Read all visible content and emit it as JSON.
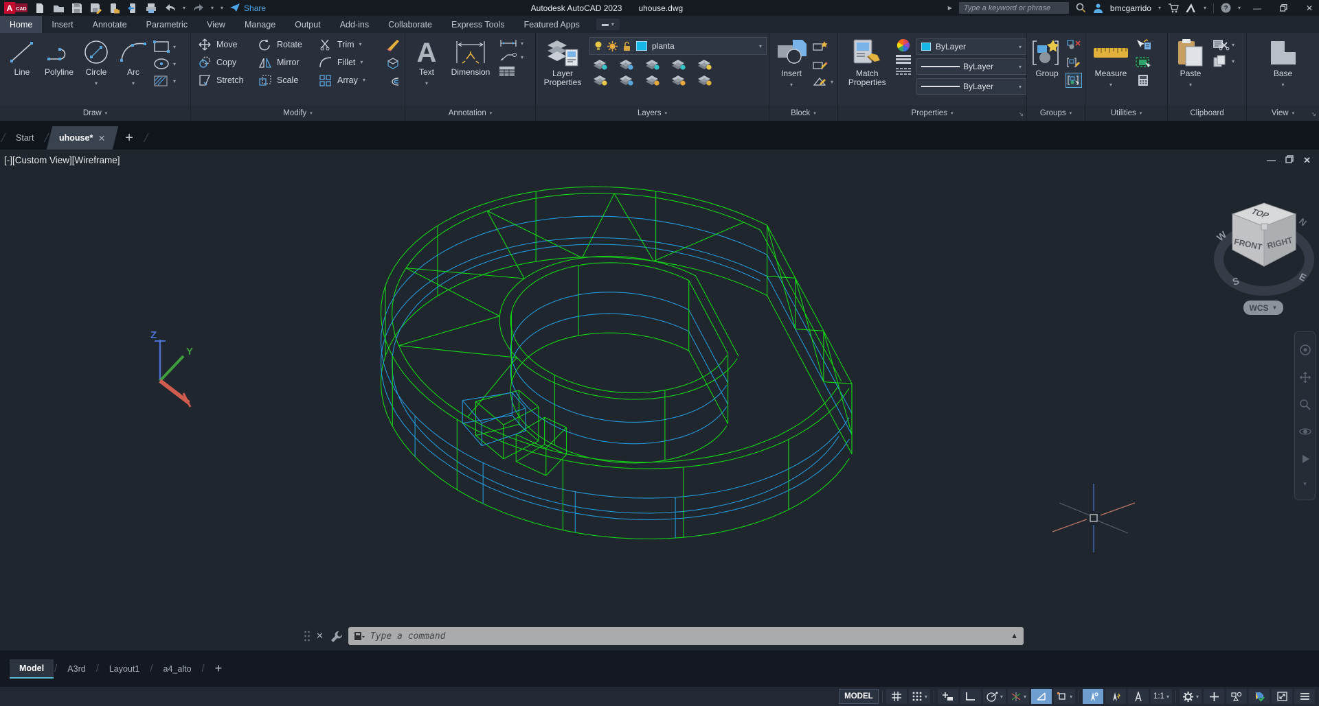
{
  "title_bar": {
    "app_title": "Autodesk AutoCAD 2023",
    "doc_title": "uhouse.dwg",
    "share_label": "Share",
    "search_placeholder": "Type a keyword or phrase",
    "username": "bmcgarrido"
  },
  "ribbon_tabs": [
    {
      "label": "Home",
      "active": true
    },
    {
      "label": "Insert"
    },
    {
      "label": "Annotate"
    },
    {
      "label": "Parametric"
    },
    {
      "label": "View"
    },
    {
      "label": "Manage"
    },
    {
      "label": "Output"
    },
    {
      "label": "Add-ins"
    },
    {
      "label": "Collaborate"
    },
    {
      "label": "Express Tools"
    },
    {
      "label": "Featured Apps"
    }
  ],
  "panels": {
    "draw": {
      "label": "Draw",
      "line": "Line",
      "polyline": "Polyline",
      "circle": "Circle",
      "arc": "Arc"
    },
    "modify": {
      "label": "Modify",
      "move": "Move",
      "copy": "Copy",
      "stretch": "Stretch",
      "rotate": "Rotate",
      "mirror": "Mirror",
      "scale": "Scale",
      "trim": "Trim",
      "fillet": "Fillet",
      "array": "Array"
    },
    "annotation": {
      "label": "Annotation",
      "text": "Text",
      "dimension": "Dimension"
    },
    "layers": {
      "label": "Layers",
      "layer_properties": "Layer Properties",
      "current_layer": "planta"
    },
    "block": {
      "label": "Block",
      "insert": "Insert"
    },
    "properties": {
      "label": "Properties",
      "match": "Match Properties",
      "color": "ByLayer",
      "lineweight": "ByLayer",
      "linetype": "ByLayer"
    },
    "groups": {
      "label": "Groups",
      "group": "Group"
    },
    "utilities": {
      "label": "Utilities",
      "measure": "Measure"
    },
    "clipboard": {
      "label": "Clipboard",
      "paste": "Paste"
    },
    "view": {
      "label": "View",
      "base": "Base"
    }
  },
  "file_tabs": [
    {
      "label": "Start",
      "active": false
    },
    {
      "label": "uhouse*",
      "active": true
    }
  ],
  "viewport": {
    "label": "[-][Custom View][Wireframe]",
    "viewcube": {
      "top": "TOP",
      "front": "FRONT",
      "right": "RIGHT",
      "w": "W",
      "s": "S",
      "e": "E",
      "n": "N",
      "wcs": "WCS"
    }
  },
  "command_line": {
    "placeholder": "Type a command"
  },
  "layout_tabs": [
    {
      "label": "Model",
      "active": true
    },
    {
      "label": "A3rd"
    },
    {
      "label": "Layout1"
    },
    {
      "label": "a4_alto"
    }
  ],
  "status_bar": {
    "model_label": "MODEL",
    "annotation_scale": "1:1"
  },
  "colors": {
    "wire_green": "#15d615",
    "wire_cyan": "#2498d8",
    "accent_blue": "#4fa0dc",
    "icon_yellow": "#e0b23c",
    "swatch_cyan": "#17b7e8"
  }
}
